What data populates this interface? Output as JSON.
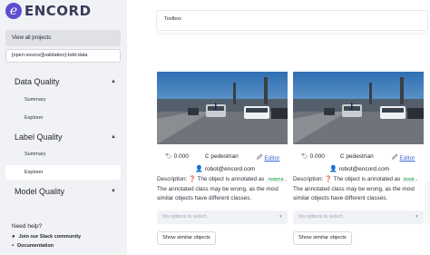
{
  "brand": {
    "logo_letter": "e",
    "name": "ENCORD",
    "color": "#5a4fcf"
  },
  "sidebar": {
    "view_all": "View all projects",
    "dataset": "[open-source][validation]-bdd-data",
    "sections": [
      {
        "label": "Data Quality",
        "expanded": true,
        "items": [
          "Summary",
          "Explorer"
        ]
      },
      {
        "label": "Label Quality",
        "expanded": true,
        "items": [
          "Summary",
          "Explorer"
        ],
        "active_item": "Explorer"
      },
      {
        "label": "Model Quality",
        "expanded": false,
        "items": []
      }
    ],
    "help_title": "Need help?",
    "help_links": [
      {
        "label": "Join our Slack community",
        "icon": "slack-icon"
      },
      {
        "label": "Documentation",
        "icon": "book-icon"
      }
    ]
  },
  "toolbox": {
    "label": "Toolbox"
  },
  "cards": [
    {
      "score": "0.000",
      "class_name": "pedestrian",
      "editor_label": "Editor",
      "user": "robot@encord.com",
      "desc_prefix": "Description:",
      "desc_mid": "The object is annotated as",
      "desc_code": "remote",
      "desc_suffix": ". The annotated class may be wrong, as the most similar objects have different classes.",
      "select_placeholder": "No options to select.",
      "button": "Show similar objects"
    },
    {
      "score": "0.000",
      "class_name": "pedestrian",
      "editor_label": "Editor",
      "user": "robot@encord.com",
      "desc_prefix": "Description:",
      "desc_mid": "The object is annotated as",
      "desc_code": "book",
      "desc_suffix": ". The annotated class may be wrong, as the most similar objects have different classes.",
      "select_placeholder": "No options to select.",
      "button": "Show similar objects"
    }
  ],
  "glyphs": {
    "tag": "🏷",
    "class": "Ͼ",
    "editor": "🖉",
    "user": "👤",
    "question": "❓",
    "chev_up": "▲",
    "chev_down": "▼",
    "caret": "▼",
    "slack": "●",
    "doc": "▪"
  }
}
